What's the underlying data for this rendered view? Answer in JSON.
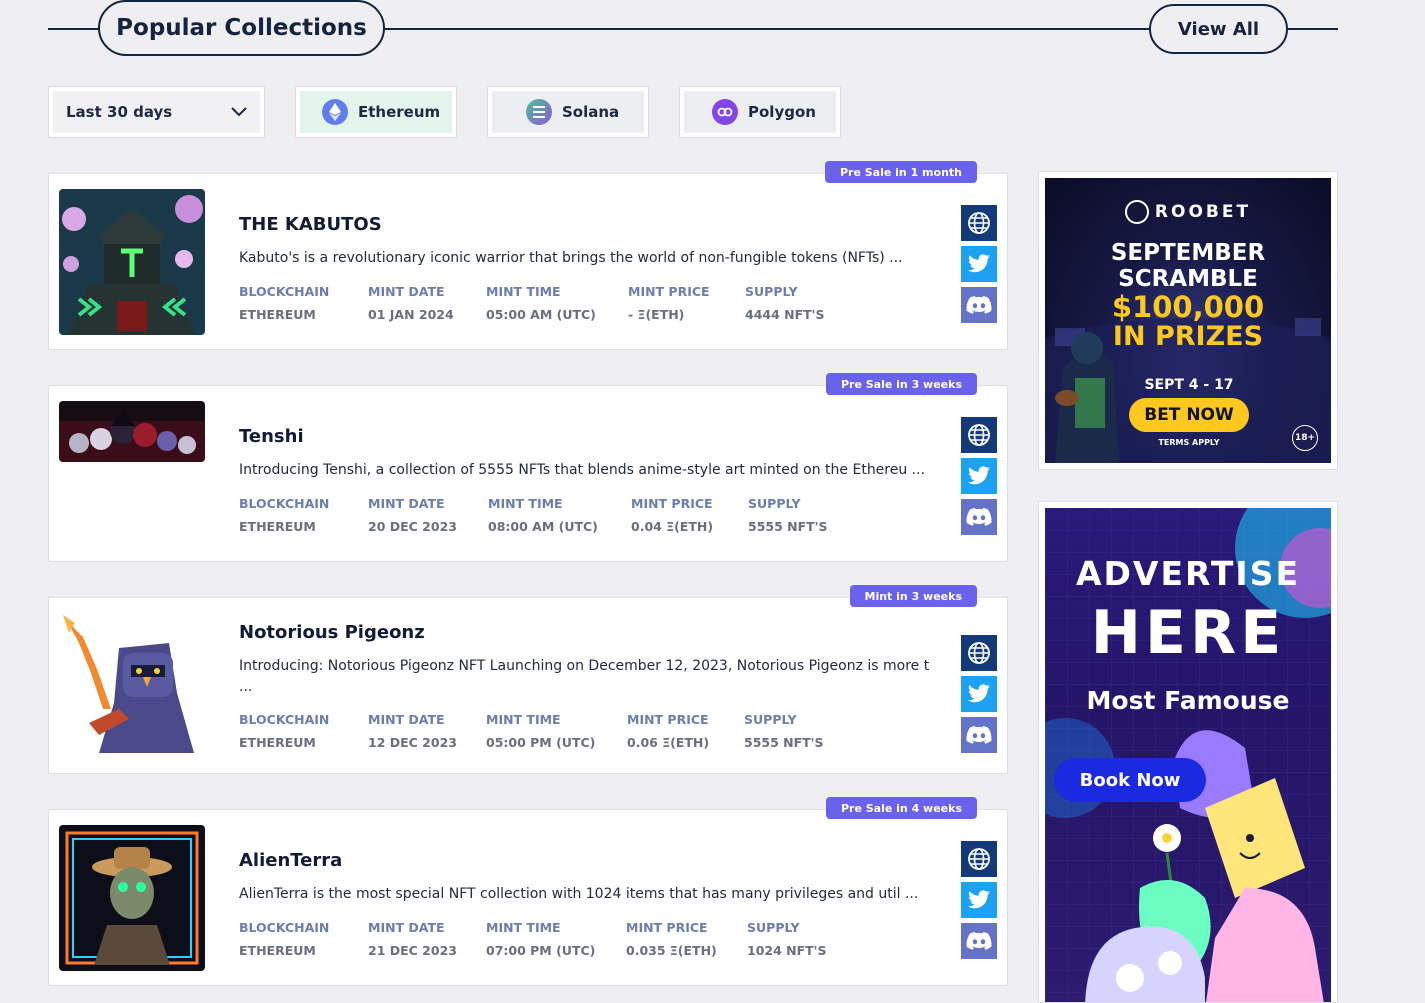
{
  "header": {
    "title": "Popular Collections",
    "view_all": "View All"
  },
  "filters": {
    "range": "Last 30 days",
    "chains": [
      "Ethereum",
      "Solana",
      "Polygon"
    ]
  },
  "meta_labels": {
    "blockchain": "BLOCKCHAIN",
    "mint_date": "MINT DATE",
    "mint_time": "MINT TIME",
    "mint_price": "MINT PRICE",
    "supply": "SUPPLY"
  },
  "collections": [
    {
      "badge": "Pre Sale in 1 month",
      "name": "THE KABUTOS",
      "desc": "Kabuto's is a revolutionary iconic warrior that brings the world of non-fungible tokens (NFTs) ...",
      "blockchain": "ETHEREUM",
      "mint_date": "01 JAN 2024",
      "mint_time": "05:00 AM (UTC)",
      "mint_price": "- Ξ(ETH)",
      "supply": "4444 NFT'S"
    },
    {
      "badge": "Pre Sale in 3 weeks",
      "name": "Tenshi",
      "desc": "Introducing Tenshi, a collection of 5555 NFTs that blends anime-style art minted on the Ethereu ...",
      "blockchain": "ETHEREUM",
      "mint_date": "20 DEC 2023",
      "mint_time": "08:00 AM (UTC)",
      "mint_price": "0.04 Ξ(ETH)",
      "supply": "5555 NFT'S"
    },
    {
      "badge": "Mint in 3 weeks",
      "name": "Notorious Pigeonz",
      "desc": "Introducing: Notorious Pigeonz NFT Launching on December 12, 2023, Notorious Pigeonz is more t ...",
      "blockchain": "ETHEREUM",
      "mint_date": "12 DEC 2023",
      "mint_time": "05:00 PM (UTC)",
      "mint_price": "0.06 Ξ(ETH)",
      "supply": "5555 NFT'S"
    },
    {
      "badge": "Pre Sale in 4 weeks",
      "name": "AlienTerra",
      "desc": "AlienTerra is the most special NFT collection with 1024 items that has many privileges and util ...",
      "blockchain": "ETHEREUM",
      "mint_date": "21 DEC 2023",
      "mint_time": "07:00 PM (UTC)",
      "mint_price": "0.035 Ξ(ETH)",
      "supply": "1024 NFT'S"
    }
  ],
  "ads": {
    "roobet": {
      "brand": "ROOBET",
      "line1": "SEPTEMBER",
      "line2": "SCRAMBLE",
      "prize": "$100,000",
      "prize2": "IN PRIZES",
      "dates": "SEPT 4 - 17",
      "cta": "BET NOW",
      "terms": "TERMS APPLY",
      "age": "18+"
    },
    "advertise": {
      "line1": "ADVERTISE",
      "line2": "HERE",
      "line3": "Most Famouse",
      "cta": "Book Now"
    }
  },
  "colors": {
    "accent": "#6a62ec",
    "navy": "#14233f",
    "twitter": "#1da1f2",
    "discord": "#6472c8",
    "web": "#143a7a"
  }
}
